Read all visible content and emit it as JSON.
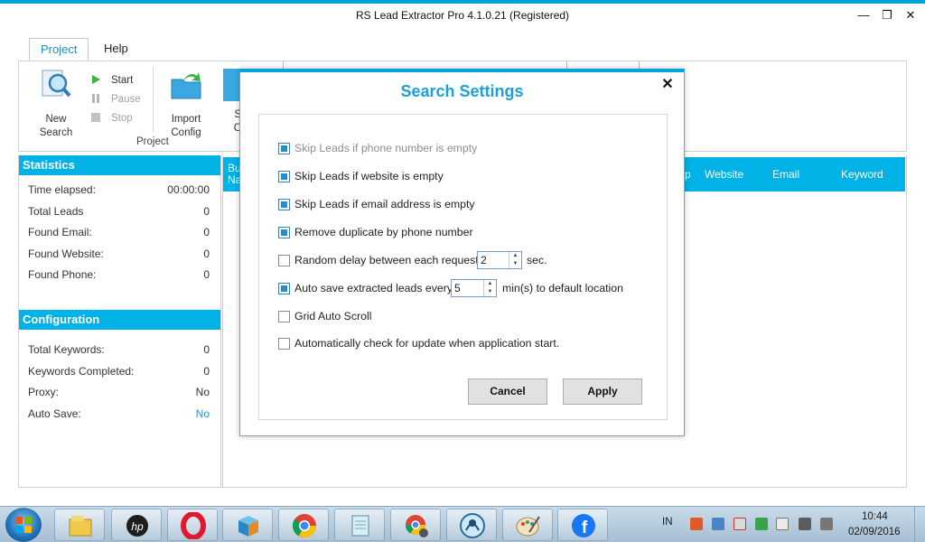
{
  "window": {
    "title": "RS Lead Extractor Pro 4.1.0.21 (Registered)",
    "minimize": "—",
    "restore": "❐",
    "close": "✕"
  },
  "ribbon": {
    "tabs": [
      {
        "label": "Project",
        "active": true
      },
      {
        "label": "Help",
        "active": false
      }
    ],
    "new_search": "New\nSearch",
    "new_search_l1": "New",
    "new_search_l2": "Search",
    "start": "Start",
    "pause": "Pause",
    "stop": "Stop",
    "import_l1": "Import",
    "import_l2": "Config",
    "save_l1": "S",
    "save_l2": "C",
    "group_label": "Project"
  },
  "statistics": {
    "header": "Statistics",
    "rows": [
      {
        "label": "Time elapsed:",
        "value": "00:00:00"
      },
      {
        "label": "Total Leads",
        "value": "0"
      },
      {
        "label": "Found Email:",
        "value": "0"
      },
      {
        "label": "Found Website:",
        "value": "0"
      },
      {
        "label": "Found Phone:",
        "value": "0"
      }
    ]
  },
  "configuration": {
    "header": "Configuration",
    "rows": [
      {
        "label": "Total Keywords:",
        "value": "0"
      },
      {
        "label": "Keywords Completed:",
        "value": "0"
      },
      {
        "label": "Proxy:",
        "value": "No"
      },
      {
        "label": "Auto Save:",
        "value": "No"
      }
    ]
  },
  "grid": {
    "columns": [
      "Bu Na",
      "p",
      "Website",
      "Email",
      "Keyword"
    ],
    "col_bu_1": "Bu",
    "col_bu_2": "Na"
  },
  "dialog": {
    "title": "Search Settings",
    "close": "✕",
    "options": [
      {
        "label": "Skip Leads if phone number is empty",
        "checked": true,
        "disabled": true
      },
      {
        "label": "Skip Leads if website is empty",
        "checked": true,
        "disabled": false
      },
      {
        "label": "Skip Leads if email address is empty",
        "checked": true,
        "disabled": false
      },
      {
        "label": "Remove duplicate by phone number",
        "checked": true,
        "disabled": false
      },
      {
        "label": "Random delay between each request",
        "checked": false,
        "disabled": false
      },
      {
        "label": "Auto save extracted leads every",
        "checked": true,
        "disabled": false
      },
      {
        "label": "Grid Auto Scroll",
        "checked": false,
        "disabled": false
      },
      {
        "label": "Automatically check for update when application start.",
        "checked": false,
        "disabled": false
      }
    ],
    "delay_value": "2",
    "delay_unit": "sec.",
    "autosave_value": "5",
    "autosave_unit": "min(s) to default location",
    "cancel": "Cancel",
    "apply": "Apply"
  },
  "taskbar": {
    "lang": "IN",
    "time": "10:44",
    "date": "02/09/2016",
    "apps": [
      "file-explorer-icon",
      "hp-icon",
      "opera-icon",
      "box-icon",
      "chrome-icon",
      "notepad-icon",
      "chrome-settings-icon",
      "rs-lead-extractor-icon",
      "paint-icon",
      "facebook-icon"
    ]
  },
  "colors": {
    "accent": "#00b2e6",
    "title_blue": "#1aa0dc"
  }
}
